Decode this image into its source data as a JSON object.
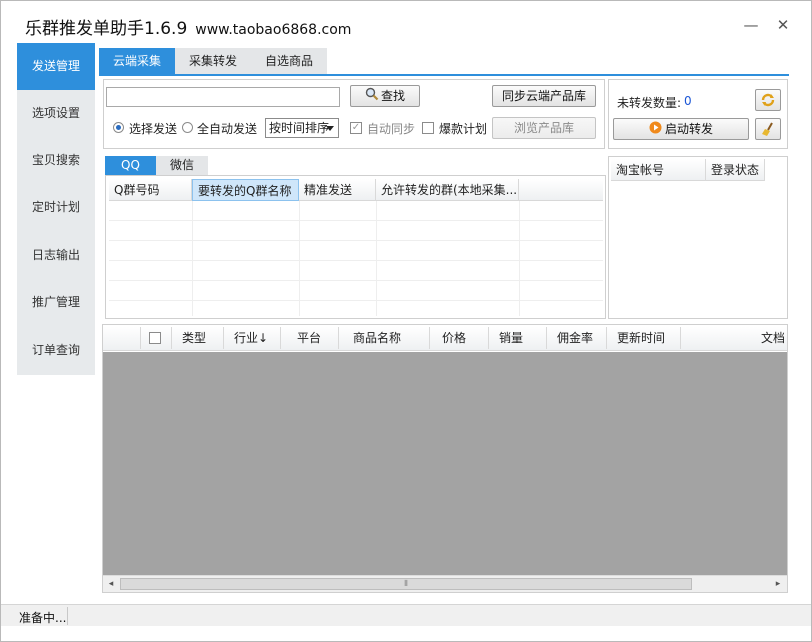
{
  "window": {
    "title": "乐群推发单助手1.6.9",
    "url": "www.taobao6868.com",
    "minimize_glyph": "—",
    "close_glyph": "✕"
  },
  "sidebar": {
    "items": [
      {
        "label": "发送管理",
        "active": true
      },
      {
        "label": "选项设置"
      },
      {
        "label": "宝贝搜索"
      },
      {
        "label": "定时计划"
      },
      {
        "label": "日志输出"
      },
      {
        "label": "推广管理"
      },
      {
        "label": "订单查询"
      }
    ]
  },
  "tabs": [
    {
      "label": "云端采集",
      "active": true
    },
    {
      "label": "采集转发"
    },
    {
      "label": "自选商品"
    }
  ],
  "toolbar": {
    "search_placeholder": "",
    "search_button": "查找",
    "sync_button": "同步云端产品库",
    "browse_button": "浏览产品库",
    "radio_select_send": "选择发送",
    "radio_auto_send": "全自动发送",
    "sort_select": "按时间排序",
    "auto_sync": "自动同步",
    "hot_plan": "爆款计划"
  },
  "right_panel": {
    "unforwarded_label": "未转发数量:",
    "unforwarded_count": "0",
    "start_button": "启动转发",
    "col_account": "淘宝帐号",
    "col_login_status": "登录状态",
    "refresh_icon": "refresh-icon",
    "broom_icon": "broom-icon"
  },
  "group_tabs": [
    {
      "label": "QQ",
      "active": true
    },
    {
      "label": "微信"
    }
  ],
  "group_table": {
    "columns": [
      "Q群号码",
      "要转发的Q群名称",
      "精准发送",
      "允许转发的群(本地采集..."
    ]
  },
  "product_table": {
    "columns": [
      "类型",
      "行业",
      "平台",
      "商品名称",
      "价格",
      "销量",
      "佣金率",
      "更新时间",
      "文档"
    ],
    "industry_sort_glyph": "↓"
  },
  "scrollbar": {
    "left_glyph": "◂",
    "right_glyph": "▸",
    "thumb_glyph": "⦀"
  },
  "status": {
    "text": "准备中..."
  },
  "colors": {
    "accent": "#2e8fdc",
    "grid_gray": "#a3a3a3",
    "count_blue": "#1b56d6"
  }
}
